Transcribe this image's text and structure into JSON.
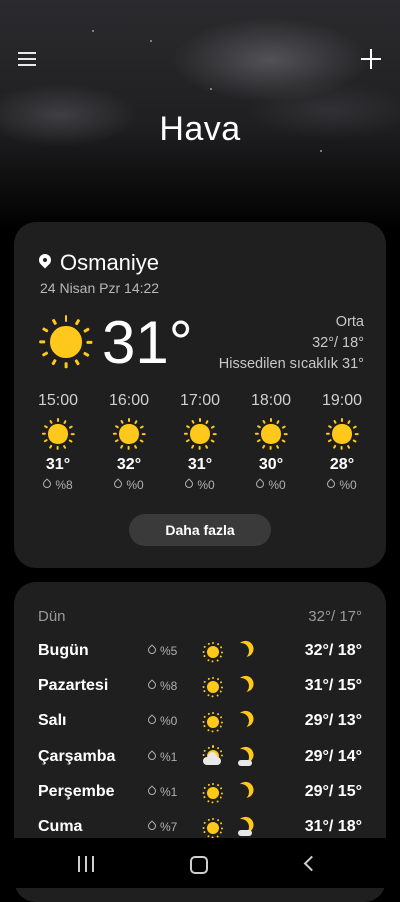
{
  "header": {
    "title": "Hava",
    "menu_icon": "menu-icon",
    "add_icon": "plus-icon"
  },
  "current": {
    "location": "Osmaniye",
    "datetime": "24 Nisan Pzr 14:22",
    "temperature": "31°",
    "condition": "Orta",
    "high_low": "32°/ 18°",
    "feels_like": "Hissedilen sıcaklık 31°",
    "icon": "sun-icon"
  },
  "hourly": [
    {
      "time": "15:00",
      "temp": "31°",
      "rain": "%8",
      "icon": "sun-icon"
    },
    {
      "time": "16:00",
      "temp": "32°",
      "rain": "%0",
      "icon": "sun-icon"
    },
    {
      "time": "17:00",
      "temp": "31°",
      "rain": "%0",
      "icon": "sun-icon"
    },
    {
      "time": "18:00",
      "temp": "30°",
      "rain": "%0",
      "icon": "sun-icon"
    },
    {
      "time": "19:00",
      "temp": "28°",
      "rain": "%0",
      "icon": "sun-icon"
    }
  ],
  "more_button": "Daha fazla",
  "yesterday": {
    "label": "Dün",
    "temps": "32°/ 17°"
  },
  "daily": [
    {
      "day": "Bugün",
      "rain": "%5",
      "temps": "32°/ 18°",
      "day_icon": "sun-icon",
      "night_icon": "moon-icon"
    },
    {
      "day": "Pazartesi",
      "rain": "%8",
      "temps": "31°/ 15°",
      "day_icon": "sun-icon",
      "night_icon": "moon-icon"
    },
    {
      "day": "Salı",
      "rain": "%0",
      "temps": "29°/ 13°",
      "day_icon": "sun-icon",
      "night_icon": "moon-icon"
    },
    {
      "day": "Çarşamba",
      "rain": "%1",
      "temps": "29°/ 14°",
      "day_icon": "partly-cloudy-icon",
      "night_icon": "moon-cloud-icon"
    },
    {
      "day": "Perşembe",
      "rain": "%1",
      "temps": "29°/ 15°",
      "day_icon": "sun-icon",
      "night_icon": "moon-icon"
    },
    {
      "day": "Cuma",
      "rain": "%7",
      "temps": "31°/ 18°",
      "day_icon": "sun-icon",
      "night_icon": "moon-cloud-icon"
    }
  ],
  "navbar": {
    "recents_icon": "recents-icon",
    "home_icon": "home-icon",
    "back_icon": "back-icon"
  },
  "colors": {
    "sun": "#ffc81a",
    "card_bg": "#1f1f1f",
    "background": "#000000"
  }
}
